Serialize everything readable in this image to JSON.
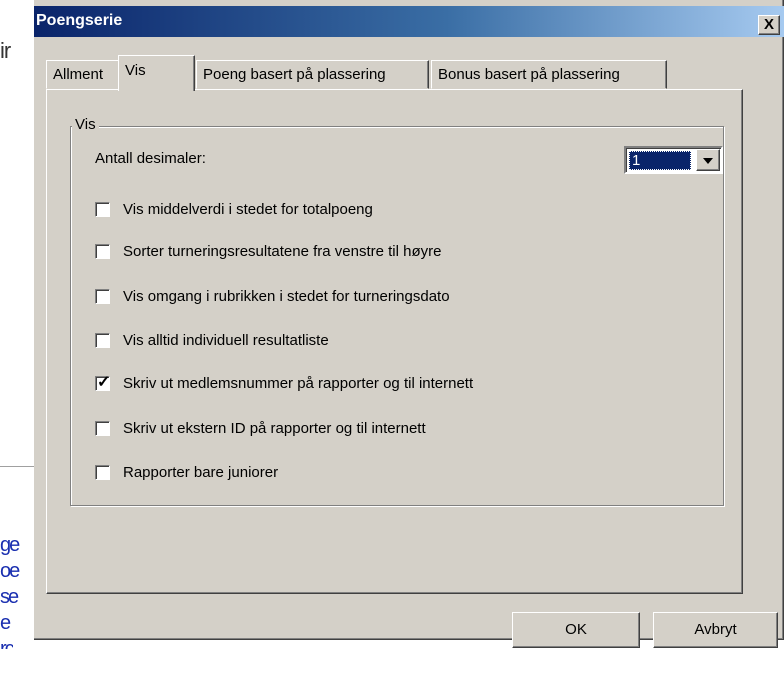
{
  "background": {
    "top_text": "ir",
    "links": [
      "ge",
      "oe",
      "se",
      "e",
      "rc"
    ]
  },
  "dialog": {
    "title": "Poengserie",
    "close_label": "X"
  },
  "tabs": [
    {
      "label": "Allment",
      "active": false
    },
    {
      "label": "Vis",
      "active": true
    },
    {
      "label": "Poeng basert på plassering",
      "active": false
    },
    {
      "label": "Bonus basert på plassering",
      "active": false
    }
  ],
  "group": {
    "label": "Vis",
    "decimals_label": "Antall desimaler:",
    "decimals_value": "1"
  },
  "options": [
    {
      "label": "Vis middelverdi i stedet for totalpoeng",
      "checked": false
    },
    {
      "label": "Sorter turneringsresultatene fra venstre til høyre",
      "checked": false
    },
    {
      "label": "Vis omgang i rubrikken i stedet for turneringsdato",
      "checked": false
    },
    {
      "label": "Vis alltid individuell resultatliste",
      "checked": false
    },
    {
      "label": "Skriv ut medlemsnummer på rapporter og til internett",
      "checked": true
    },
    {
      "label": "Skriv ut ekstern ID på rapporter og til internett",
      "checked": false
    },
    {
      "label": "Rapporter bare juniorer",
      "checked": false
    }
  ],
  "buttons": {
    "ok": "OK",
    "cancel": "Avbryt"
  },
  "colors": {
    "titlebar_start": "#0a246a",
    "titlebar_end": "#a6caf0",
    "face": "#d4d0c8",
    "selection": "#0a246a"
  }
}
